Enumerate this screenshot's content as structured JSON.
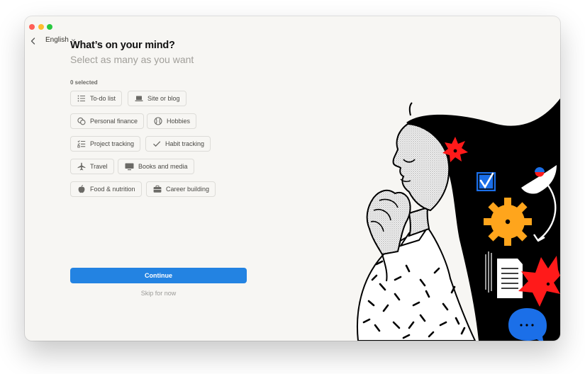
{
  "window": {
    "traffic_lights": [
      "close",
      "minimize",
      "maximize"
    ]
  },
  "nav": {
    "back_icon": "chevron-left-icon",
    "language": "English",
    "language_icon": "chevron-down-icon"
  },
  "header": {
    "title": "What’s on your mind?",
    "subtitle": "Select as many as you want"
  },
  "selection": {
    "count_text": "0 selected"
  },
  "chips": [
    {
      "label": "To-do list",
      "icon": "list-icon"
    },
    {
      "label": "Site or blog",
      "icon": "laptop-icon"
    },
    {
      "label": "Personal finance",
      "icon": "coins-icon"
    },
    {
      "label": "Hobbies",
      "icon": "baseball-icon"
    },
    {
      "label": "Project tracking",
      "icon": "checklist-icon"
    },
    {
      "label": "Habit tracking",
      "icon": "checkmark-icon"
    },
    {
      "label": "Travel",
      "icon": "airplane-icon"
    },
    {
      "label": "Books and media",
      "icon": "monitor-icon"
    },
    {
      "label": "Food & nutrition",
      "icon": "apple-icon"
    },
    {
      "label": "Career building",
      "icon": "briefcase-icon"
    }
  ],
  "actions": {
    "continue_label": "Continue",
    "skip_label": "Skip for now"
  },
  "colors": {
    "accent": "#2383e2",
    "background": "#f7f6f3",
    "chip_border": "#dddcd8",
    "illustration_red": "#ff1a1a",
    "illustration_blue": "#1b6fe8",
    "illustration_yellow": "#ffa51c"
  }
}
